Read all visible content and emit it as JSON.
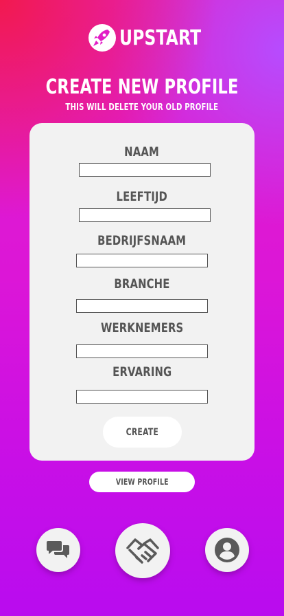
{
  "header": {
    "brand_name": "UPSTART",
    "logo_icon": "rocket-icon",
    "title": "CREATE NEW PROFILE",
    "subtitle": "THIS WILL DELETE YOUR OLD PROFILE"
  },
  "form": {
    "fields": [
      {
        "label": "NAAM",
        "value": ""
      },
      {
        "label": "LEEFTIJD",
        "value": ""
      },
      {
        "label": "BEDRIJFSNAAM",
        "value": ""
      },
      {
        "label": "BRANCHE",
        "value": ""
      },
      {
        "label": "WERKNEMERS",
        "value": ""
      },
      {
        "label": "ERVARING",
        "value": ""
      }
    ],
    "create_label": "CREATE"
  },
  "view_profile_label": "VIEW PROFILE",
  "nav": {
    "items": [
      {
        "icon": "chat-bubbles-icon"
      },
      {
        "icon": "handshake-icon"
      },
      {
        "icon": "account-icon"
      }
    ]
  },
  "colors": {
    "card": "#f2f2f2",
    "text_gray": "#555555",
    "white": "#ffffff",
    "gradient_top_left": "#f2194f",
    "gradient_main": "#dc16d7",
    "gradient_bottom": "#b90cef"
  }
}
